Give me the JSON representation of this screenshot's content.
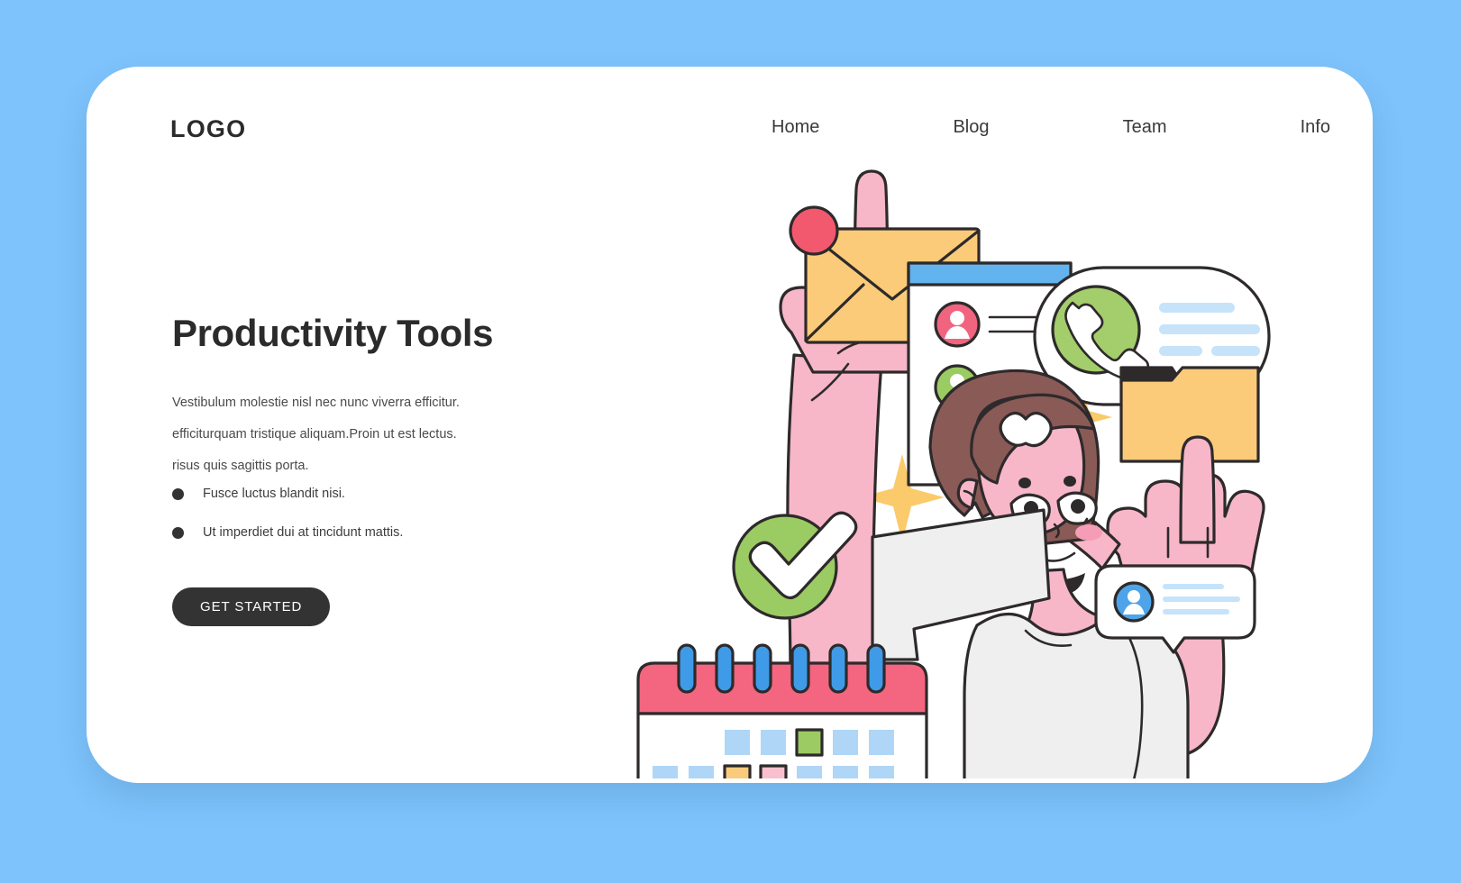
{
  "page": {
    "background_color": "#7EC3FB",
    "card_color": "#FFFFFF"
  },
  "header": {
    "logo": "LOGO",
    "nav": [
      {
        "label": "Home"
      },
      {
        "label": "Blog"
      },
      {
        "label": "Team"
      },
      {
        "label": "Info"
      }
    ]
  },
  "hero": {
    "headline": "Productivity Tools",
    "paragraphs": [
      "Vestibulum molestie nisl nec nunc viverra efficitur.",
      "efficiturquam tristique aliquam.Proin ut est lectus.",
      "risus quis sagittis porta."
    ],
    "bullets": [
      "Fusce luctus blandit nisi.",
      "Ut imperdiet dui at tincidunt mattis."
    ],
    "cta_label": "GET STARTED"
  },
  "illustration": {
    "title": "woman raising both hands surrounded by productivity app icons",
    "colors": {
      "outline": "#2E2A2B",
      "skin": "#F7B7C8",
      "skin_shadow": "#F19FB4",
      "hair": "#8A5A57",
      "shirt": "#EFEFEF",
      "envelope": "#FBC96B",
      "envelope_light": "#FDD98F",
      "pink_badge": "#F2596F",
      "green": "#9BCB63",
      "green_phone": "#A3CE6B",
      "blue_bar": "#62B3EE",
      "blue_cell": "#AFD6F6",
      "blue_line": "#C6E3FA",
      "folder": "#FBCB79",
      "calendar_band": "#F4657F",
      "spiral_blue": "#3F9BE8",
      "star_yellow": "#FBCA6B",
      "cell_pink": "#F8C0CE",
      "cell_orange": "#FACB7A",
      "cell_green": "#9DCB63",
      "avatar_pink": "#F0647F",
      "avatar_green": "#9BCB63",
      "avatar_yellow": "#FBC96B",
      "avatar_blue": "#4FA3E8"
    },
    "elements": [
      {
        "name": "envelope-icon",
        "note": "yellow envelope with pink notification dot, held on left index finger"
      },
      {
        "name": "left-hand",
        "note": "pink hand pointing up"
      },
      {
        "name": "contact-list-card",
        "note": "white card with blue title bar and 3 avatar rows"
      },
      {
        "name": "phone-bubble",
        "note": "rounded speech bubble with green phone badge and blue text lines"
      },
      {
        "name": "folder-icon",
        "note": "yellow folder touched by right index finger"
      },
      {
        "name": "right-hand",
        "note": "pink hand pointing up"
      },
      {
        "name": "check-badge",
        "note": "green circle with white check mark"
      },
      {
        "name": "chat-bubble",
        "note": "white rounded chat bubble with blue avatar and text lines"
      },
      {
        "name": "calendar-icon",
        "note": "calendar with pink header, blue spiral rings and colored day cells"
      },
      {
        "name": "character",
        "note": "woman with brown bob hair, white tee"
      },
      {
        "name": "sparkle-star",
        "note": "four-pointed yellow stars, 3 instances"
      }
    ],
    "contact_rows": [
      {
        "avatar_color": "#F0647F"
      },
      {
        "avatar_color": "#9BCB63"
      },
      {
        "avatar_color": "#FBC96B"
      }
    ],
    "calendar": {
      "rows": [
        [
          "empty",
          "empty",
          "blue",
          "blue",
          "green",
          "blue",
          "blue"
        ],
        [
          "blue",
          "blue",
          "orange",
          "pink",
          "blue",
          "blue",
          "blue"
        ],
        [
          "blue",
          "green",
          "blue",
          "blue",
          "pink",
          "blue",
          "orange"
        ],
        [
          "pink",
          "blue",
          "blue",
          "blue",
          "empty",
          "empty",
          "empty"
        ]
      ],
      "ring_count": 6
    }
  }
}
